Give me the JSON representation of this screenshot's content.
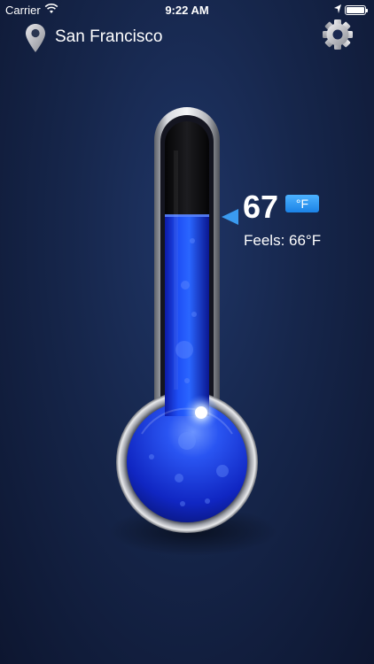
{
  "status_bar": {
    "carrier": "Carrier",
    "time": "9:22 AM",
    "icons": [
      "wifi-icon",
      "location-arrow-icon",
      "battery-icon"
    ]
  },
  "header": {
    "city": "San Francisco",
    "location_icon": "map-pin-icon",
    "settings_icon": "gear-icon"
  },
  "thermometer": {
    "temperature": "67",
    "unit": "°F",
    "feels_like": "Feels: 66°F",
    "fill_level": 0.52,
    "colors": {
      "liquid": "#1e3ff0",
      "tube_empty": "#121214",
      "pointer": "#3a9af0",
      "unit_button": "#2390f0"
    }
  }
}
